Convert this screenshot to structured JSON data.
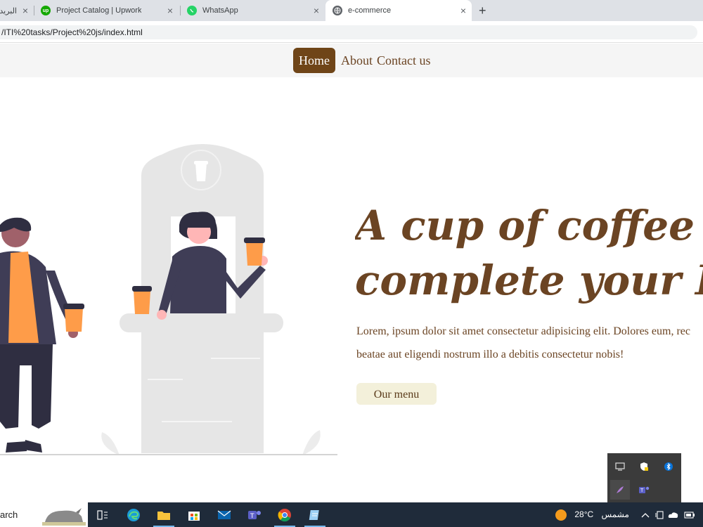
{
  "browser": {
    "tabs": [
      {
        "label": "البريد",
        "icon": "mail-icon",
        "active": false
      },
      {
        "label": "Project Catalog | Upwork",
        "icon": "upwork-icon",
        "active": false
      },
      {
        "label": "WhatsApp",
        "icon": "whatsapp-icon",
        "active": false
      },
      {
        "label": "e-commerce",
        "icon": "globe-icon",
        "active": true
      }
    ],
    "new_tab": "+",
    "close": "×",
    "address": "/ITI%20tasks/Project%20js/index.html"
  },
  "site": {
    "nav": [
      {
        "label": "Home",
        "active": true
      },
      {
        "label": "About",
        "active": false
      },
      {
        "label": "Contact us",
        "active": false
      }
    ],
    "hero": {
      "title_line1": "A cup of coffee to",
      "title_line2": "complete your Day",
      "text_line1": "Lorem, ipsum dolor sit amet consectetur adipisicing elit. Dolores eum, rec",
      "text_line2": "beatae aut eligendi nostrum illo a debitis consectetur nobis!",
      "button": "Our menu"
    },
    "colors": {
      "brand": "#6f4518",
      "button_bg": "#f3f0da",
      "accent_orange": "#fe9c49"
    }
  },
  "taskbar": {
    "search_text": "arch",
    "weather_temp": "28°C",
    "weather_text": "مشمس"
  },
  "tray_icons": [
    "monitor-icon",
    "security-shield-icon",
    "bluetooth-icon",
    "feather-icon",
    "teams-icon"
  ]
}
